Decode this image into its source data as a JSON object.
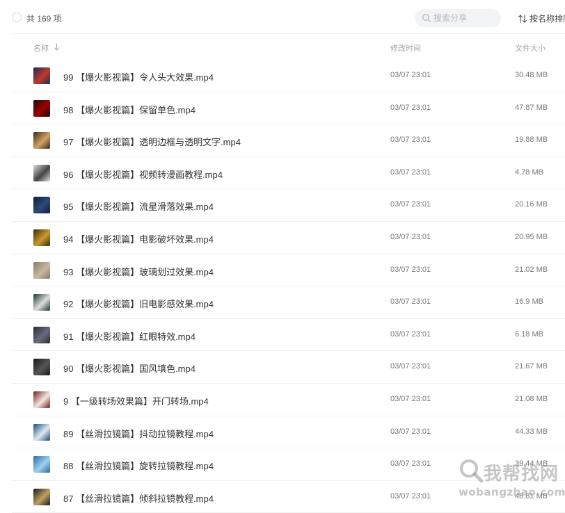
{
  "toolbar": {
    "count_label": "共 169 项",
    "search_placeholder": "搜索分享",
    "sort_label": "按名称排序"
  },
  "columns": {
    "name": "名称",
    "time": "修改时间",
    "size": "文件大小"
  },
  "files": [
    {
      "name": "99 【爆火影视篇】令人头大效果.mp4",
      "time": "03/07 23:01",
      "size": "30.48 MB",
      "thumb_colors": [
        "#1a2a5a",
        "#c0392b"
      ]
    },
    {
      "name": "98 【爆火影视篇】保留单色.mp4",
      "time": "03/07 23:01",
      "size": "47.87 MB",
      "thumb_colors": [
        "#111111",
        "#a00000"
      ]
    },
    {
      "name": "97 【爆火影视篇】透明边框与透明文字.mp4",
      "time": "03/07 23:01",
      "size": "19.88 MB",
      "thumb_colors": [
        "#3a2a1a",
        "#d4a060"
      ]
    },
    {
      "name": "96 【爆火影视篇】视频转漫画教程.mp4",
      "time": "03/07 23:01",
      "size": "4.78 MB",
      "thumb_colors": [
        "#dddddd",
        "#444444"
      ]
    },
    {
      "name": "95 【爆火影视篇】流星滑落效果.mp4",
      "time": "03/07 23:01",
      "size": "20.16 MB",
      "thumb_colors": [
        "#0f1e3a",
        "#2c4a7a"
      ]
    },
    {
      "name": "94 【爆火影视篇】电影破坏效果.mp4",
      "time": "03/07 23:01",
      "size": "20.95 MB",
      "thumb_colors": [
        "#3a2a05",
        "#c89a30"
      ]
    },
    {
      "name": "93 【爆火影视篇】玻璃划过效果.mp4",
      "time": "03/07 23:01",
      "size": "21.02 MB",
      "thumb_colors": [
        "#8a7a6a",
        "#c8b8a0"
      ]
    },
    {
      "name": "92 【爆火影视篇】旧电影感效果.mp4",
      "time": "03/07 23:01",
      "size": "16.9 MB",
      "thumb_colors": [
        "#1a3a2a",
        "#dddddd"
      ]
    },
    {
      "name": "91 【爆火影视篇】红眼特效.mp4",
      "time": "03/07 23:01",
      "size": "6.18 MB",
      "thumb_colors": [
        "#2a2a35",
        "#6a6a80"
      ]
    },
    {
      "name": "90 【爆火影视篇】国风填色.mp4",
      "time": "03/07 23:01",
      "size": "21.67 MB",
      "thumb_colors": [
        "#1a1a1a",
        "#555555"
      ]
    },
    {
      "name": "9 【一级转场效果篇】开门转场.mp4",
      "time": "03/07 23:01",
      "size": "21.08 MB",
      "thumb_colors": [
        "#7a1a1a",
        "#f0e8e0"
      ]
    },
    {
      "name": "89 【丝滑拉镜篇】抖动拉镜教程.mp4",
      "time": "03/07 23:01",
      "size": "44.33 MB",
      "thumb_colors": [
        "#1a4a7a",
        "#e0e8f0"
      ]
    },
    {
      "name": "88 【丝滑拉镜篇】旋转拉镜教程.mp4",
      "time": "03/07 23:01",
      "size": "39.44 MB",
      "thumb_colors": [
        "#2a6aa0",
        "#a0d0f0"
      ]
    },
    {
      "name": "87 【丝滑拉镜篇】倾斜拉镜教程.mp4",
      "time": "03/07 23:01",
      "size": "48.81 MB",
      "thumb_colors": [
        "#1a1a1a",
        "#c0a060"
      ]
    }
  ],
  "watermark": {
    "text_cn": "我帮找网",
    "text_url": "wobangzhao.com"
  }
}
